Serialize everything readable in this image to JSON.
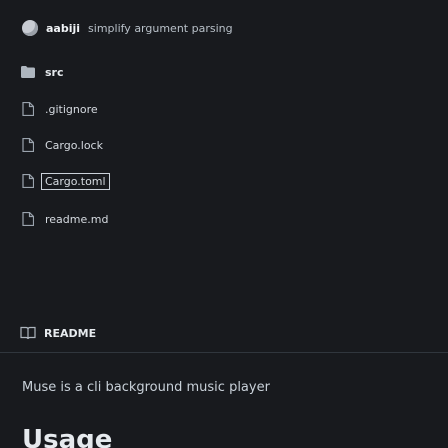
{
  "repo": {
    "owner": "aabiji",
    "description": "simplify argument parsing"
  },
  "files": [
    {
      "name": "src",
      "type": "dir",
      "icon": "folder-icon"
    },
    {
      "name": ".gitignore",
      "type": "file",
      "icon": "file-icon"
    },
    {
      "name": "Cargo.lock",
      "type": "file",
      "icon": "file-icon"
    },
    {
      "name": "Cargo.toml",
      "type": "file",
      "icon": "file-icon",
      "highlighted": true
    },
    {
      "name": "readme.md",
      "type": "file",
      "icon": "file-icon"
    }
  ],
  "readme": {
    "title": "README",
    "description": "Muse is a cli background music player",
    "heading": "Usage"
  }
}
